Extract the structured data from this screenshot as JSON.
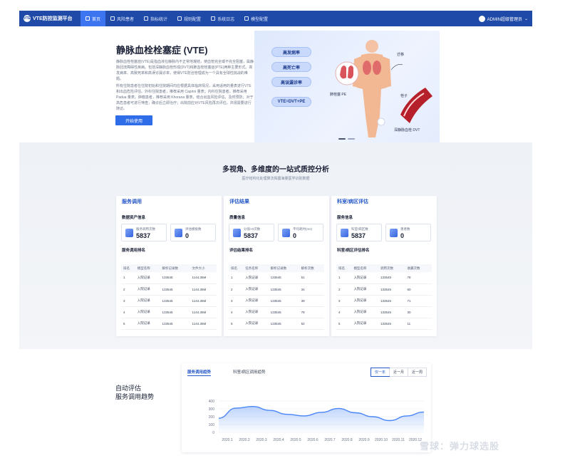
{
  "nav": {
    "brand": "VTE防控监测平台",
    "logo_text": "VTE",
    "tabs": [
      {
        "label": "首页",
        "icon": "home-icon",
        "active": true
      },
      {
        "label": "风险患者",
        "icon": "patient-icon"
      },
      {
        "label": "指标统计",
        "icon": "stats-icon"
      },
      {
        "label": "规则配置",
        "icon": "rule-icon"
      },
      {
        "label": "系统日志",
        "icon": "log-icon"
      },
      {
        "label": "模型配置",
        "icon": "model-icon"
      }
    ],
    "user": "ADMIN超级管理员"
  },
  "hero": {
    "title": "静脉血栓栓塞症 (VTE)",
    "p1": "静脉血栓栓塞症(VTE)是指血液在静脉内不正常地凝结，使血管完全或不完全阻塞，属静脉回流障碍性疾病。包括深静脉血栓形成(DVT)和肺血栓栓塞症(PTE)两种主要形式。高发病率、高致死率和高误诊漏诊率，使得VTE防治管理成为一个具有全球性挑战的难题。",
    "p2": "所有住院患者在住院初始和住院期间均应根据具体临床情况，采用适用的量表进行VTE 和出血危险评估。外科住院患者，推荐采用 Caprini 量表；内科住院患者，推荐采用 Padua 量表。肿瘤患者，推荐采用 Khorana 量表，结合出血风险评估，及时预防；对于高危患者可进行筛查，确诊后立即治疗；出院前应对VTE风险再次评估，并视需要进行随访。",
    "button": "开始使用"
  },
  "banner": {
    "pills": [
      "高发病率",
      "高死亡率",
      "高误漏诊率",
      "VTE=DVT+PE"
    ],
    "labels": {
      "pe": "肺栓塞 PE",
      "move": "迁移",
      "clot": "栓子",
      "dvt": "深静脉血栓 DVT"
    }
  },
  "section": {
    "title": "多视角、多维度的一站式质控分析",
    "subtitle": "医疗结构化处理算法揭露海量医学识别数据"
  },
  "cards": [
    {
      "title": "服务调用",
      "sub1": "数据资产信息",
      "stats": [
        {
          "label": "服务调用次数",
          "value": "5837"
        },
        {
          "label": "评估模板数",
          "value": "0"
        }
      ],
      "sub2": "服务调用排名",
      "headers": [
        "排名",
        "模型名称",
        "解析记录数",
        "文件大小"
      ],
      "rows": [
        [
          "1",
          "入院记录",
          "133545",
          "1144.35M"
        ],
        [
          "2",
          "入院记录",
          "133545",
          "1144.35M"
        ],
        [
          "3",
          "入院记录",
          "133545",
          "1144.35M"
        ],
        [
          "4",
          "入院记录",
          "133545",
          "1144.35M"
        ],
        [
          "5",
          "入院记录",
          "133545",
          "1144.35M"
        ]
      ]
    },
    {
      "title": "评估结果",
      "sub1": "质量信息",
      "stats": [
        {
          "label": "分值>0次数",
          "value": "5837"
        },
        {
          "label": "平均耗时(ms)",
          "value": "0"
        }
      ],
      "sub2": "评估结果排名",
      "headers": [
        "排名",
        "任务名称",
        "解析记录数",
        "解析次数"
      ],
      "rows": [
        [
          "1",
          "入院记录",
          "133545",
          "51"
        ],
        [
          "2",
          "入院记录",
          "133545",
          "34"
        ],
        [
          "3",
          "入院记录",
          "133545",
          "39"
        ],
        [
          "4",
          "入院记录",
          "133545",
          "78"
        ],
        [
          "5",
          "入院记录",
          "133545",
          "52"
        ]
      ]
    },
    {
      "title": "科室/病区评估",
      "sub1": "服务信息",
      "stats": [
        {
          "label": "科室/病区数",
          "value": "5837"
        },
        {
          "label": "患者数",
          "value": "0"
        }
      ],
      "sub2": "科室/病区评估排名",
      "headers": [
        "排名",
        "模型名称",
        "调用次数",
        "收藏次数"
      ],
      "rows": [
        [
          "1",
          "入院记录",
          "133545",
          "78"
        ],
        [
          "2",
          "入院记录",
          "133545",
          "60"
        ],
        [
          "3",
          "入院记录",
          "133545",
          "71"
        ],
        [
          "4",
          "入院记录",
          "133545",
          "30"
        ],
        [
          "5",
          "入院记录",
          "133545",
          "11"
        ]
      ]
    }
  ],
  "trend": {
    "title_line1": "自动评估",
    "title_line2": "服务调用趋势",
    "tabs": [
      "服务调用趋势",
      "科室/病区调用趋势"
    ],
    "ranges": [
      "仅一年",
      "近一月",
      "近一周"
    ],
    "active_range": "仅一年"
  },
  "chart_data": {
    "type": "area",
    "x": [
      "2020.1",
      "2020.2",
      "2020.3",
      "2020.4",
      "2020.5",
      "2020.6",
      "2020.7",
      "2020.8",
      "2020.9",
      "2020.10",
      "2020.11",
      "2020.12"
    ],
    "values": [
      180,
      310,
      330,
      280,
      230,
      210,
      255,
      305,
      250,
      200,
      150,
      210,
      260
    ],
    "ylim": [
      0,
      400
    ],
    "yticks": [
      "400",
      "300",
      "200",
      "100",
      "0"
    ],
    "color": "#4a86f7",
    "grid": true
  },
  "watermark": "雪球：弹力球选股"
}
